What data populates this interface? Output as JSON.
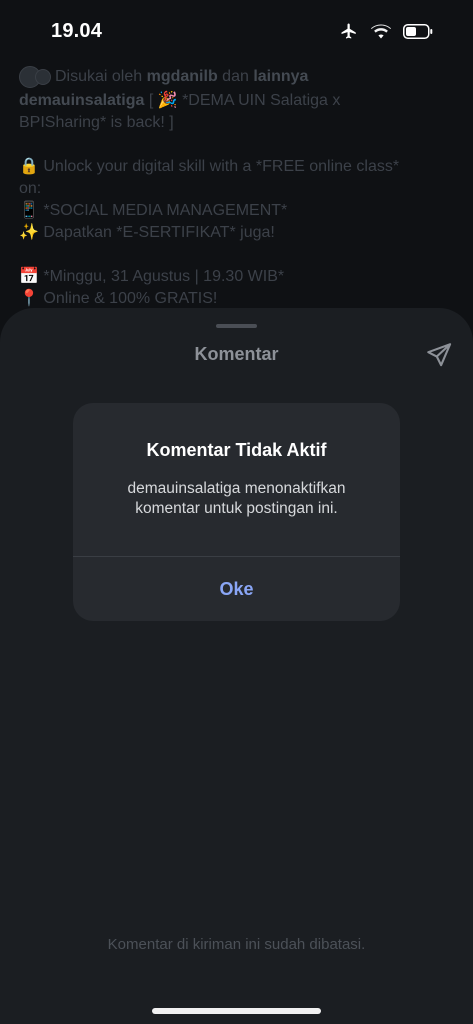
{
  "status_bar": {
    "time": "19.04",
    "icons": [
      "airplane-icon",
      "wifi-icon",
      "battery-icon"
    ]
  },
  "post": {
    "likes": {
      "prefix": "Disukai oleh ",
      "user": "mgdanilb",
      "middle": " dan ",
      "others": "lainnya"
    },
    "caption_user": "demauinsalatiga",
    "caption_first": " [ 🎉 *DEMA UIN Salatiga x",
    "lines": [
      "BPISharing* is back! ]",
      "",
      "🔒 Unlock your digital skill with a *FREE online class*",
      "on:",
      "📱 *SOCIAL MEDIA MANAGEMENT*",
      "✨ Dapatkan *E-SERTIFIKAT* juga!",
      "",
      "📅 *Minggu, 31 Agustus | 19.30 WIB*",
      "📍 Online & 100% GRATIS!"
    ]
  },
  "sheet": {
    "title": "Komentar",
    "send_icon": "send-icon",
    "restricted_text": "Komentar di kiriman ini sudah dibatasi."
  },
  "alert": {
    "title": "Komentar Tidak Aktif",
    "message": "demauinsalatiga menonaktifkan komentar untuk postingan ini.",
    "ok_label": "Oke"
  },
  "colors": {
    "background": "#0f1114",
    "sheet": "#1b1e22",
    "alert": "#272a2f",
    "accent": "#8aa6f6"
  }
}
